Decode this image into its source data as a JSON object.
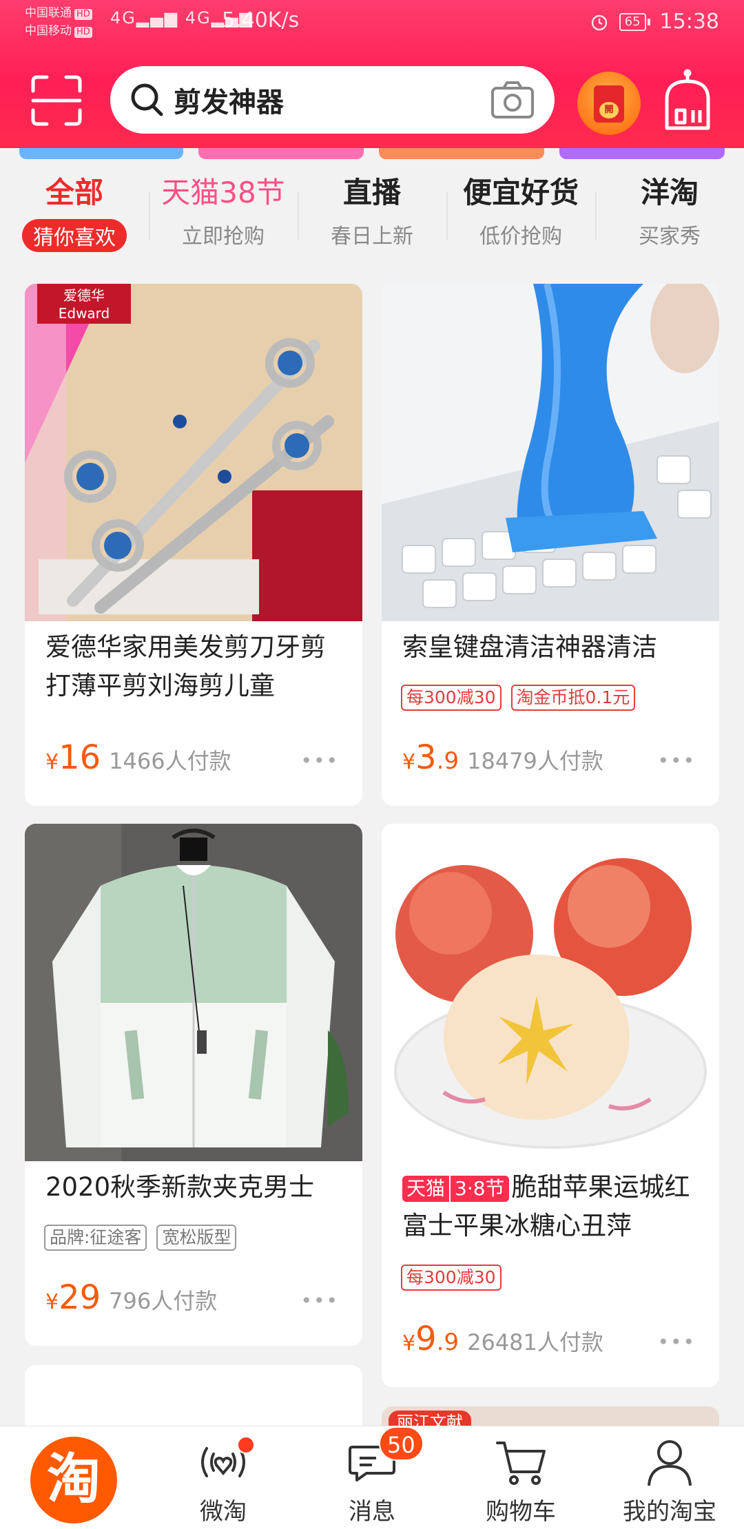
{
  "status_bar": {
    "carrier1": "中国联通",
    "carrier2": "中国移动",
    "hd": "HD",
    "signal": "4G",
    "speed": "5.40K/s",
    "battery": "65",
    "time": "15:38"
  },
  "header": {
    "search_query": "剪发神器",
    "red_packet_label": "開"
  },
  "categories": [
    {
      "title": "全部",
      "sub": "猜你喜欢"
    },
    {
      "title": "天猫38节",
      "sub": "立即抢购"
    },
    {
      "title": "直播",
      "sub": "春日上新"
    },
    {
      "title": "便宜好货",
      "sub": "低价抢购"
    },
    {
      "title": "洋淘",
      "sub": "买家秀"
    }
  ],
  "products": [
    {
      "brand_logo": "爱德华 Edward",
      "title": "爱德华家用美发剪刀牙剪打薄平剪刘海剪儿童",
      "currency": "¥",
      "price": "16",
      "payers": "1466人付款"
    },
    {
      "title": "索皇键盘清洁神器清洁",
      "tags": [
        "每300减30",
        "淘金币抵0.1元"
      ],
      "currency": "¥",
      "price_int": "3",
      "price_dec": ".9",
      "payers": "18479人付款"
    },
    {
      "title": "2020秋季新款夹克男士",
      "tags": [
        "品牌:征途客",
        "宽松版型"
      ],
      "currency": "¥",
      "price": "29",
      "payers": "796人付款"
    },
    {
      "badge_a": "天猫",
      "badge_b": "3·8节",
      "title": "脆甜苹果运城红富士平果冰糖心丑萍",
      "tags": [
        "每300减30"
      ],
      "currency": "¥",
      "price_int": "9",
      "price_dec": ".9",
      "payers": "26481人付款"
    }
  ],
  "partial_card_badge": "丽江文献",
  "bottom_nav": {
    "home_glyph": "淘",
    "items": [
      "微淘",
      "消息",
      "购物车",
      "我的淘宝"
    ],
    "message_count": "50"
  },
  "colors": {
    "header_red": "#ff2a55",
    "price_orange": "#f45a10",
    "tag_red": "#e23c3c",
    "home_orange": "#ff5a00"
  }
}
